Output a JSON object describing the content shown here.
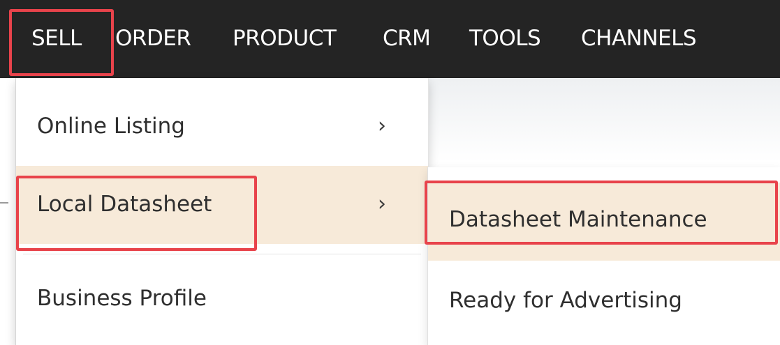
{
  "navbar": {
    "items": [
      "SELL",
      "ORDER",
      "PRODUCT",
      "CRM",
      "TOOLS",
      "CHANNELS"
    ],
    "active": "SELL"
  },
  "sell_menu": {
    "items": [
      {
        "label": "Online Listing",
        "has_submenu": true,
        "chevron": "›"
      },
      {
        "label": "Local Datasheet",
        "has_submenu": true,
        "chevron": "›",
        "hovered": true
      },
      {
        "label": "Business Profile",
        "has_submenu": false
      }
    ]
  },
  "local_datasheet_submenu": {
    "items": [
      {
        "label": "Datasheet Maintenance",
        "hovered": true
      },
      {
        "label": "Ready for Advertising"
      }
    ]
  },
  "colors": {
    "navbar_bg": "#242424",
    "hover_bg": "#f7ead9",
    "highlight_border": "#e8434b"
  },
  "icons": [
    "chevron-right-icon"
  ]
}
